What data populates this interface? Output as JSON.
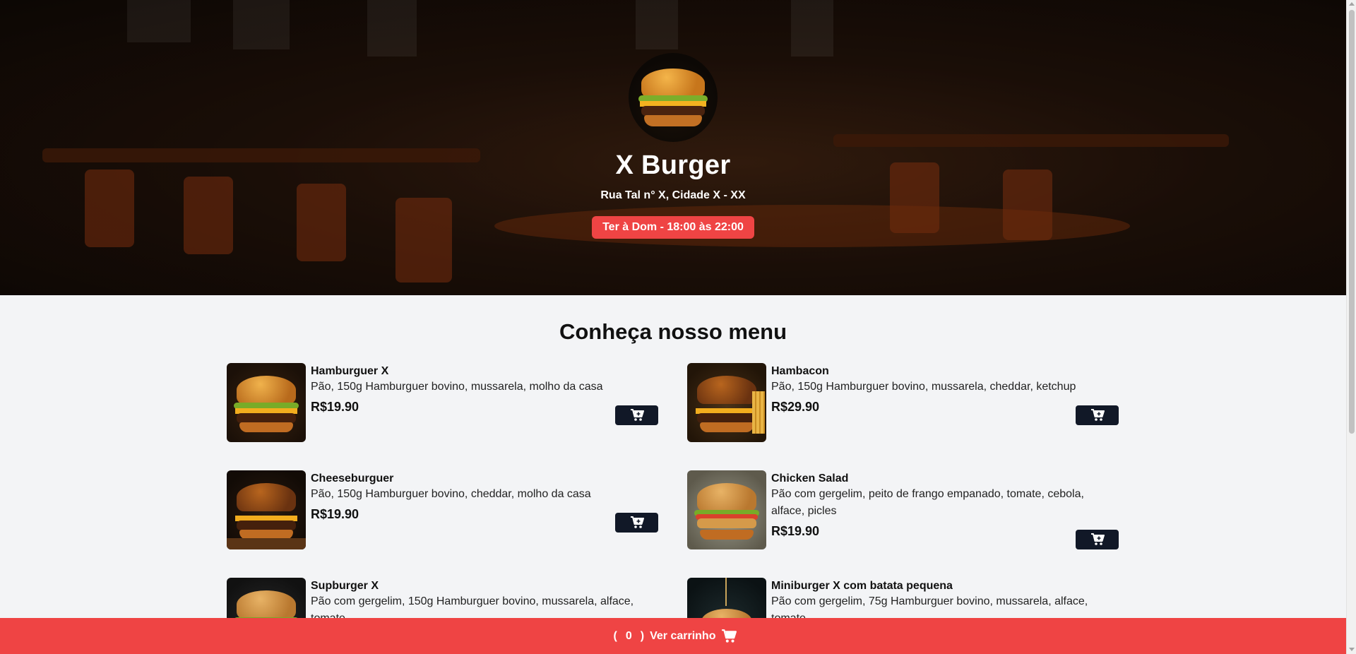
{
  "restaurant": {
    "name": "X Burger",
    "address": "Rua Tal n° X, Cidade X - XX",
    "hours": "Ter à Dom - 18:00 às 22:00"
  },
  "menu": {
    "title": "Conheça nosso menu",
    "items": [
      {
        "name": "Hamburguer X",
        "description": "Pão, 150g Hamburguer bovino, mussarela, molho da casa",
        "price": "R$19.90"
      },
      {
        "name": "Hambacon",
        "description": "Pão, 150g Hamburguer bovino, mussarela, cheddar, ketchup",
        "price": "R$29.90"
      },
      {
        "name": "Cheeseburguer",
        "description": "Pão, 150g Hamburguer bovino, cheddar, molho da casa",
        "price": "R$19.90"
      },
      {
        "name": "Chicken Salad",
        "description": "Pão com gergelim, peito de frango empanado, tomate, cebola, alface, picles",
        "price": "R$19.90"
      },
      {
        "name": "Supburger X",
        "description": "Pão com gergelim, 150g Hamburguer bovino, mussarela, alface, tomate",
        "price": ""
      },
      {
        "name": "Miniburger X com batata pequena",
        "description": "Pão com gergelim, 75g Hamburguer bovino, mussarela, alface, tomate",
        "price": ""
      }
    ]
  },
  "cart": {
    "open_paren": "(",
    "count": "0",
    "close_paren": ")",
    "label": "Ver carrinho",
    "icon": "cart-icon"
  },
  "colors": {
    "accent": "#ef4444",
    "button_dark": "#111827",
    "page_bg": "#f3f4f6"
  }
}
